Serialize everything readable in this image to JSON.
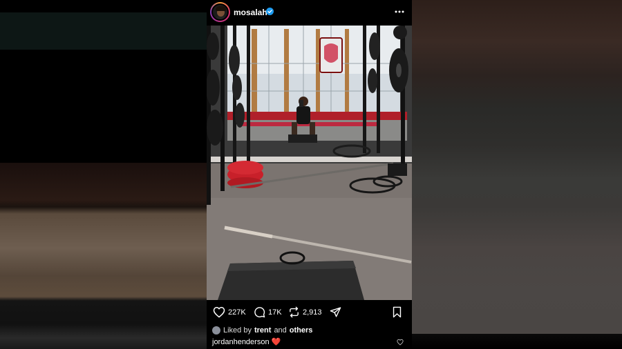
{
  "post": {
    "username": "mosalah",
    "verified": true,
    "more_icon": "more-horizontal-icon",
    "image_alt": "Gym mirror selfie with weight racks, barbell and plyo box"
  },
  "actions": {
    "likes": "227K",
    "comments": "17K",
    "reposts": "2,913",
    "like_icon": "heart-icon",
    "comment_icon": "comment-icon",
    "repost_icon": "repost-icon",
    "share_icon": "send-icon",
    "save_icon": "bookmark-icon"
  },
  "liked_by": {
    "prefix": "Liked by",
    "user": "trent",
    "connector": "and",
    "others": "others"
  },
  "comment": {
    "user": "jordanhenderson",
    "text": "❤️"
  },
  "colors": {
    "verified_blue": "#1d9bf0",
    "accent_red": "#e0245e"
  }
}
